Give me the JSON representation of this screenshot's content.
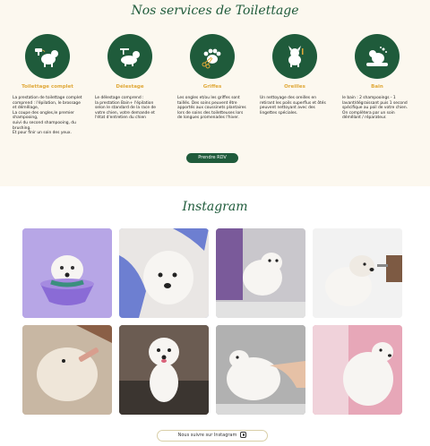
{
  "services": {
    "title": "Nos services de Toilettage",
    "items": [
      {
        "icon": "dog-hairdryer-icon",
        "name": "Toilettage complet",
        "description": "La prestation de toilettage complet comprend : l'épilation, le brossage et démêlage,\nLa coupe des ongles,le premier shampooing,\nsuivi du second shampooing, du brushing.\nEt pour finir un soin des yeux."
      },
      {
        "icon": "dog-grooming-icon",
        "name": "Délestage",
        "description": "Le délestage comprend :\nla prestation Bain+ l'épilation selon le standard de la race de votre chien, votre demande et l'état d'entretien du chien"
      },
      {
        "icon": "paw-scissors-icon",
        "name": "Griffes",
        "description": "Les ongles et/ou les griffes sont taillés. Des soins peuvent être apportés aux coussinets plantaires lors de soins des toiletteuses lors de longues promenades l'hiver."
      },
      {
        "icon": "dog-ears-icon",
        "name": "Oreilles",
        "description": "Un nettoyage des oreilles en retirant les poils superflus et ôtés peuvent nettoyant avec des lingettes spéciales."
      },
      {
        "icon": "dog-bath-icon",
        "name": "Bain",
        "description": "le bain : 2 shampooings - 1 lavant/dégraissant puis 1 second spécifique au poil de votre chien. On complètera par un soin démêlant / réparateur."
      }
    ],
    "cta_label": "Prendre RDV"
  },
  "instagram": {
    "title": "Instagram",
    "follow_label": "Nous suivre sur Instagram",
    "photos": [
      {
        "alt": "westie-in-tub-photo",
        "bg": "#b7a6e6"
      },
      {
        "alt": "westie-gloved-hands-photo",
        "bg": "#8fa4d6"
      },
      {
        "alt": "westie-on-table-photo",
        "bg": "#c9c7cc"
      },
      {
        "alt": "westie-trimming-photo",
        "bg": "#ededed"
      },
      {
        "alt": "westie-being-brushed-photo",
        "bg": "#c8b7a3"
      },
      {
        "alt": "westie-portrait-photo",
        "bg": "#5a4b43"
      },
      {
        "alt": "westie-grooming-table-photo",
        "bg": "#9b9b9b"
      },
      {
        "alt": "westie-pink-background-photo",
        "bg": "#e7a7b8"
      }
    ]
  },
  "colors": {
    "brand_green": "#1f5b3b",
    "accent_gold": "#e0a838",
    "cream": "#fcf8ef"
  }
}
